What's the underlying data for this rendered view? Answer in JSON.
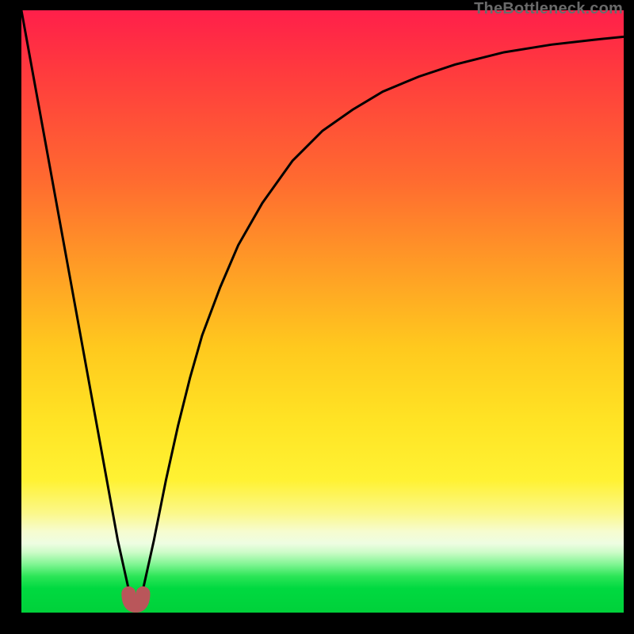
{
  "watermark": "TheBottleneck.com",
  "chart_data": {
    "type": "line",
    "title": "",
    "xlabel": "",
    "ylabel": "",
    "xlim": [
      0,
      100
    ],
    "ylim": [
      0,
      100
    ],
    "series": [
      {
        "name": "bottleneck-curve",
        "x": [
          0,
          2,
          4,
          6,
          8,
          10,
          12,
          14,
          16,
          18,
          18.5,
          19,
          19.5,
          20,
          22,
          24,
          26,
          28,
          30,
          33,
          36,
          40,
          45,
          50,
          55,
          60,
          66,
          72,
          80,
          88,
          95,
          100
        ],
        "values": [
          100,
          89,
          78,
          67,
          56,
          45,
          34,
          23,
          12,
          3,
          1.3,
          0.7,
          1.3,
          3,
          12,
          22,
          31,
          39,
          46,
          54,
          61,
          68,
          75,
          80,
          83.5,
          86.5,
          89,
          91,
          93,
          94.3,
          95.1,
          95.6
        ]
      }
    ],
    "marker": {
      "name": "optimum-region",
      "x_range": [
        17.8,
        20.2
      ],
      "y": 1.2,
      "color": "#b9565a"
    },
    "background_gradient": {
      "top": "#ff1f4a",
      "mid": "#ffe324",
      "bottom": "#00d13a"
    }
  }
}
